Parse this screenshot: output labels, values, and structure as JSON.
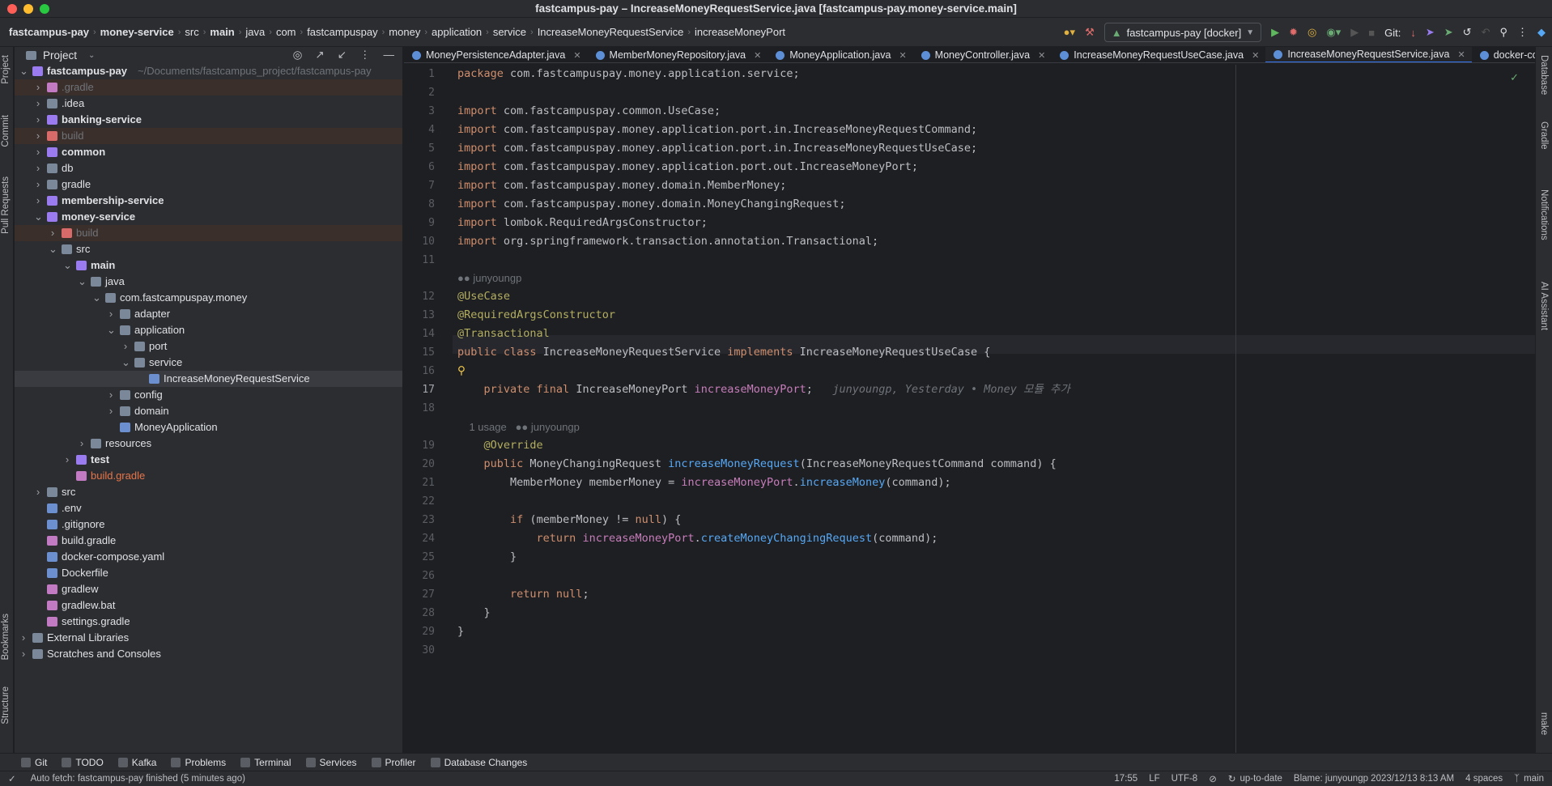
{
  "window": {
    "title": "fastcampus-pay – IncreaseMoneyRequestService.java [fastcampus-pay.money-service.main]"
  },
  "breadcrumbs": [
    "fastcampus-pay",
    "money-service",
    "src",
    "main",
    "java",
    "com",
    "fastcampuspay",
    "money",
    "application",
    "service",
    "IncreaseMoneyRequestService",
    "increaseMoneyPort"
  ],
  "toolbar": {
    "run_config": "fastcampus-pay [docker]",
    "git_label": "Git:"
  },
  "left_strip": [
    "Project",
    "Commit",
    "Pull Requests",
    "Bookmarks",
    "Structure"
  ],
  "right_strip": [
    "Database",
    "Gradle",
    "Notifications",
    "AI Assistant",
    "make"
  ],
  "project_panel": {
    "title": "Project"
  },
  "tree": [
    {
      "label": "fastcampus-pay",
      "extra": "~/Documents/fastcampus_project/fastcampus-pay",
      "depth": 0,
      "open": true,
      "bold": true
    },
    {
      "label": ".gradle",
      "depth": 1,
      "open": false,
      "dim": true,
      "hl": true
    },
    {
      "label": ".idea",
      "depth": 1,
      "open": false
    },
    {
      "label": "banking-service",
      "depth": 1,
      "open": false,
      "bold": true
    },
    {
      "label": "build",
      "depth": 1,
      "open": false,
      "dim": true,
      "hl": true
    },
    {
      "label": "common",
      "depth": 1,
      "open": false,
      "bold": true
    },
    {
      "label": "db",
      "depth": 1,
      "open": false
    },
    {
      "label": "gradle",
      "depth": 1,
      "open": false
    },
    {
      "label": "membership-service",
      "depth": 1,
      "open": false,
      "bold": true
    },
    {
      "label": "money-service",
      "depth": 1,
      "open": true,
      "bold": true
    },
    {
      "label": "build",
      "depth": 2,
      "open": false,
      "dim": true,
      "hl": true
    },
    {
      "label": "src",
      "depth": 2,
      "open": true
    },
    {
      "label": "main",
      "depth": 3,
      "open": true,
      "bold": true
    },
    {
      "label": "java",
      "depth": 4,
      "open": true
    },
    {
      "label": "com.fastcampuspay.money",
      "depth": 5,
      "open": true
    },
    {
      "label": "adapter",
      "depth": 6,
      "open": false
    },
    {
      "label": "application",
      "depth": 6,
      "open": true
    },
    {
      "label": "port",
      "depth": 7,
      "open": false
    },
    {
      "label": "service",
      "depth": 7,
      "open": true
    },
    {
      "label": "IncreaseMoneyRequestService",
      "depth": 8,
      "leaf": true,
      "selected": true
    },
    {
      "label": "config",
      "depth": 6,
      "open": false
    },
    {
      "label": "domain",
      "depth": 6,
      "open": false
    },
    {
      "label": "MoneyApplication",
      "depth": 6,
      "leaf": true
    },
    {
      "label": "resources",
      "depth": 4,
      "open": false
    },
    {
      "label": "test",
      "depth": 3,
      "open": false,
      "bold": true
    },
    {
      "label": "build.gradle",
      "depth": 3,
      "leaf": true,
      "orange": true
    },
    {
      "label": "src",
      "depth": 1,
      "open": false
    },
    {
      "label": ".env",
      "depth": 1,
      "leaf": true
    },
    {
      "label": ".gitignore",
      "depth": 1,
      "leaf": true
    },
    {
      "label": "build.gradle",
      "depth": 1,
      "leaf": true
    },
    {
      "label": "docker-compose.yaml",
      "depth": 1,
      "leaf": true
    },
    {
      "label": "Dockerfile",
      "depth": 1,
      "leaf": true
    },
    {
      "label": "gradlew",
      "depth": 1,
      "leaf": true
    },
    {
      "label": "gradlew.bat",
      "depth": 1,
      "leaf": true
    },
    {
      "label": "settings.gradle",
      "depth": 1,
      "leaf": true
    },
    {
      "label": "External Libraries",
      "depth": 0,
      "open": false
    },
    {
      "label": "Scratches and Consoles",
      "depth": 0,
      "open": false
    }
  ],
  "tabs": [
    {
      "label": "MoneyPersistenceAdapter.java",
      "active": false
    },
    {
      "label": "MemberMoneyRepository.java",
      "active": false
    },
    {
      "label": "MoneyApplication.java",
      "active": false
    },
    {
      "label": "MoneyController.java",
      "active": false
    },
    {
      "label": "IncreaseMoneyRequestUseCase.java",
      "active": false
    },
    {
      "label": "IncreaseMoneyRequestService.java",
      "active": true
    },
    {
      "label": "docker-compo",
      "active": false
    }
  ],
  "code": {
    "l1": "com.fastcampuspay.money.application.service;",
    "l3": "com.fastcampuspay.common.UseCase;",
    "l4": "com.fastcampuspay.money.application.port.in.IncreaseMoneyRequestCommand;",
    "l5": "com.fastcampuspay.money.application.port.in.IncreaseMoneyRequestUseCase;",
    "l6": "com.fastcampuspay.money.application.port.out.IncreaseMoneyPort;",
    "l7": "com.fastcampuspay.money.domain.MemberMoney;",
    "l8": "com.fastcampuspay.money.domain.MoneyChangingRequest;",
    "l9": "lombok.RequiredArgsConstructor;",
    "l10": "org.springframework.transaction.annotation.Transactional;",
    "author": "junyoungp",
    "a12": "@UseCase",
    "a13": "@RequiredArgsConstructor",
    "a14": "@Transactional",
    "cls": "IncreaseMoneyRequestService",
    "iface": "IncreaseMoneyRequestUseCase",
    "ptype": "IncreaseMoneyPort",
    "pfield": "increaseMoneyPort",
    "blame": "junyoungp, Yesterday • Money 모듈 추가",
    "usage": "1 usage",
    "override": "@Override",
    "rettype": "MoneyChangingRequest",
    "method": "increaseMoneyRequest",
    "paramtype": "IncreaseMoneyRequestCommand",
    "param": "command",
    "mmtype": "MemberMoney",
    "mmvar": "memberMoney",
    "callinc": "increaseMoney",
    "callcreate": "createMoneyChangingRequest"
  },
  "tool_windows": [
    "Git",
    "TODO",
    "Kafka",
    "Problems",
    "Terminal",
    "Services",
    "Profiler",
    "Database Changes"
  ],
  "status": {
    "message": "Auto fetch: fastcampus-pay finished (5 minutes ago)",
    "position": "17:55",
    "line_sep": "LF",
    "encoding": "UTF-8",
    "vcs": "up-to-date",
    "blame": "Blame: junyoungp 2023/12/13 8:13 AM",
    "indent": "4 spaces",
    "branch": "main"
  },
  "colors": {
    "accent": "#3574f0",
    "keyword": "#cf8e6d",
    "annotation": "#b3ae60",
    "function": "#56a8f5",
    "field": "#c77dbb"
  }
}
